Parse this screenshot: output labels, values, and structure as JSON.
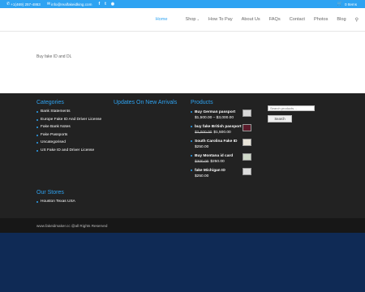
{
  "topbar": {
    "phone": "+1(469) 257-4863",
    "email": "info@realfakeidking.com",
    "social_icons": [
      "facebook-icon",
      "twitter-icon",
      "rss-icon"
    ],
    "cart_label": "0 Items"
  },
  "nav": {
    "items": [
      {
        "label": "Home",
        "active": true
      },
      {
        "label": "Shop",
        "has_dropdown": true
      },
      {
        "label": "How To Pay"
      },
      {
        "label": "About Us"
      },
      {
        "label": "FAQs"
      },
      {
        "label": "Contact"
      },
      {
        "label": "Photos"
      },
      {
        "label": "Blog"
      }
    ]
  },
  "content": {
    "text": "Buy fake ID and DL"
  },
  "footer": {
    "categories_title": "Categories",
    "categories": [
      "Bank Statements",
      "Europe Fake ID And Driver License",
      "Fake Bank Notes",
      "Fake Passports",
      "Uncategorised",
      "US Fake ID and Driver License"
    ],
    "new_arrivals_title": "Updates On New Arrivals",
    "products_title": "Products",
    "products": [
      {
        "name": "Buy German passport",
        "price": "$1,500.00 – $3,000.00",
        "old_price": ""
      },
      {
        "name": "buy fake British passport",
        "price": "$1,500.00",
        "old_price": "$2,000.00"
      },
      {
        "name": "South Carolina Fake ID",
        "price": "$250.00",
        "old_price": ""
      },
      {
        "name": "Buy Montana id card",
        "price": "$250.00",
        "old_price": "$300.00"
      },
      {
        "name": "fake Michigan ID",
        "price": "$250.00",
        "old_price": ""
      }
    ],
    "search_placeholder": "Search products…",
    "search_button": "Search",
    "stores_title": "Our Stores",
    "stores": [
      "Houston Texas USA"
    ]
  },
  "bottom_bar": {
    "copyright": "www.fakeidmaker.cc @all Rights Reserved"
  },
  "colors": {
    "accent": "#2ea3f2",
    "footer_bg": "#222222",
    "page_bg": "#0f2a55"
  }
}
